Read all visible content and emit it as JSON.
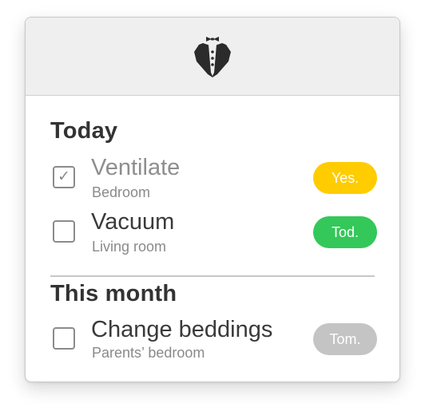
{
  "header": {
    "logo_icon": "butler-tuxedo-icon"
  },
  "sections": [
    {
      "title": "Today",
      "tasks": [
        {
          "title": "Ventilate",
          "location": "Bedroom",
          "checked": true,
          "badge": "Yes.",
          "badge_color": "#ffcc00"
        },
        {
          "title": "Vacuum",
          "location": "Living room",
          "checked": false,
          "badge": "Tod.",
          "badge_color": "#34c759"
        }
      ]
    },
    {
      "title": "This month",
      "tasks": [
        {
          "title": "Change beddings",
          "location": "Parents’ bedroom",
          "checked": false,
          "badge": "Tom.",
          "badge_color": "#c4c4c4"
        }
      ]
    }
  ],
  "colors": {
    "checkbox_border": "#8b8b8b",
    "header_bg": "#efefef"
  }
}
